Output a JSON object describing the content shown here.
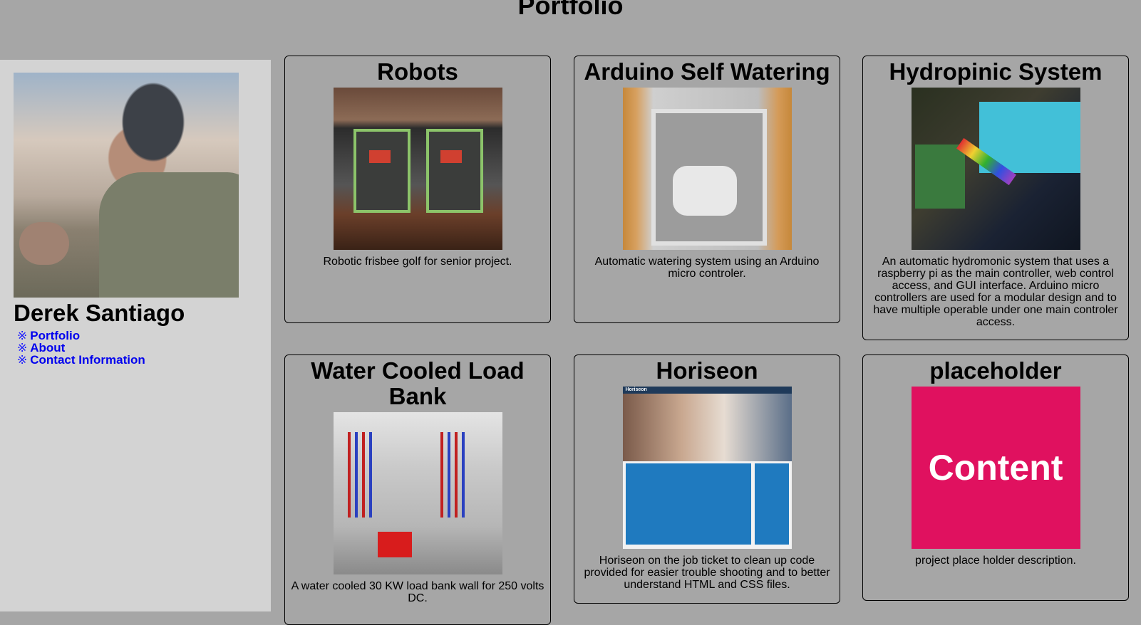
{
  "header": {
    "title": "Portfolio"
  },
  "sidebar": {
    "name": "Derek Santiago",
    "bullet": "※",
    "nav": [
      {
        "label": "Portfolio"
      },
      {
        "label": "About"
      },
      {
        "label": "Contact Information"
      }
    ]
  },
  "projects": [
    {
      "title": "Robots",
      "description": "Robotic frisbee golf for senior project."
    },
    {
      "title": "Arduino Self Watering",
      "description": "Automatic watering system using an Arduino micro controler."
    },
    {
      "title": "Hydropinic System",
      "description": "An automatic hydromonic system that uses a raspberry pi as the main controller, web control access, and GUI interface. Arduino micro controllers are used for a modular design and to have multiple operable under one main controler access."
    },
    {
      "title": "Water Cooled Load Bank",
      "description": "A water cooled 30 KW load bank wall for 250 volts DC."
    },
    {
      "title": "Horiseon",
      "description": "Horiseon on the job ticket to clean up code provided for easier trouble shooting and to better understand HTML and CSS files.",
      "image_text": "Horiseon"
    },
    {
      "title": "placeholder",
      "description": "project place holder description.",
      "image_text": "Content"
    }
  ],
  "colors": {
    "page_background": "#a6a6a6",
    "sidebar_background": "#d3d3d3",
    "link": "#0000ee",
    "placeholder_image": "#e0115f"
  }
}
